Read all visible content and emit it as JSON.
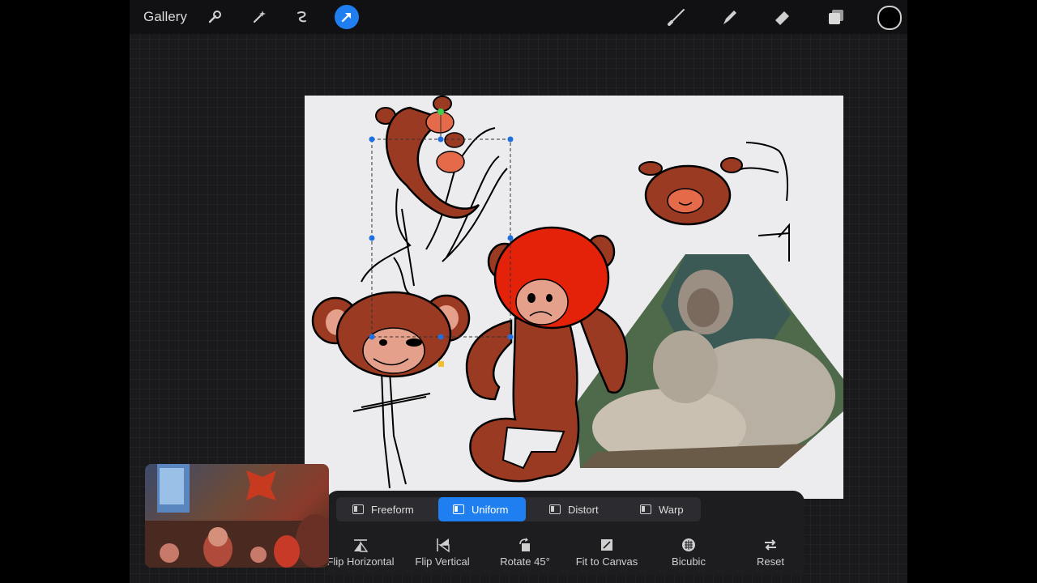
{
  "topbar": {
    "gallery_label": "Gallery",
    "left_tools": [
      "wrench-icon",
      "magic-wand-icon",
      "selection-icon",
      "transform-arrow-icon"
    ],
    "right_tools": [
      "brush-icon",
      "smudge-icon",
      "eraser-icon",
      "layers-icon"
    ],
    "current_color": "#000000"
  },
  "transform": {
    "modes": [
      {
        "label": "Freeform",
        "active": false
      },
      {
        "label": "Uniform",
        "active": true
      },
      {
        "label": "Distort",
        "active": false
      },
      {
        "label": "Warp",
        "active": false
      }
    ],
    "actions": [
      {
        "label": "Flip Horizontal",
        "icon": "flip-horizontal-icon"
      },
      {
        "label": "Flip Vertical",
        "icon": "flip-vertical-icon"
      },
      {
        "label": "Rotate 45°",
        "icon": "rotate-icon"
      },
      {
        "label": "Fit to Canvas",
        "icon": "fit-to-canvas-icon"
      },
      {
        "label": "Bicubic",
        "icon": "bicubic-icon"
      },
      {
        "label": "Reset",
        "icon": "reset-icon"
      }
    ]
  },
  "colors": {
    "accent": "#1f7ef0",
    "monkey_brown": "#9b3a23",
    "monkey_red": "#e4220a",
    "face_pink": "#e4a08a"
  }
}
